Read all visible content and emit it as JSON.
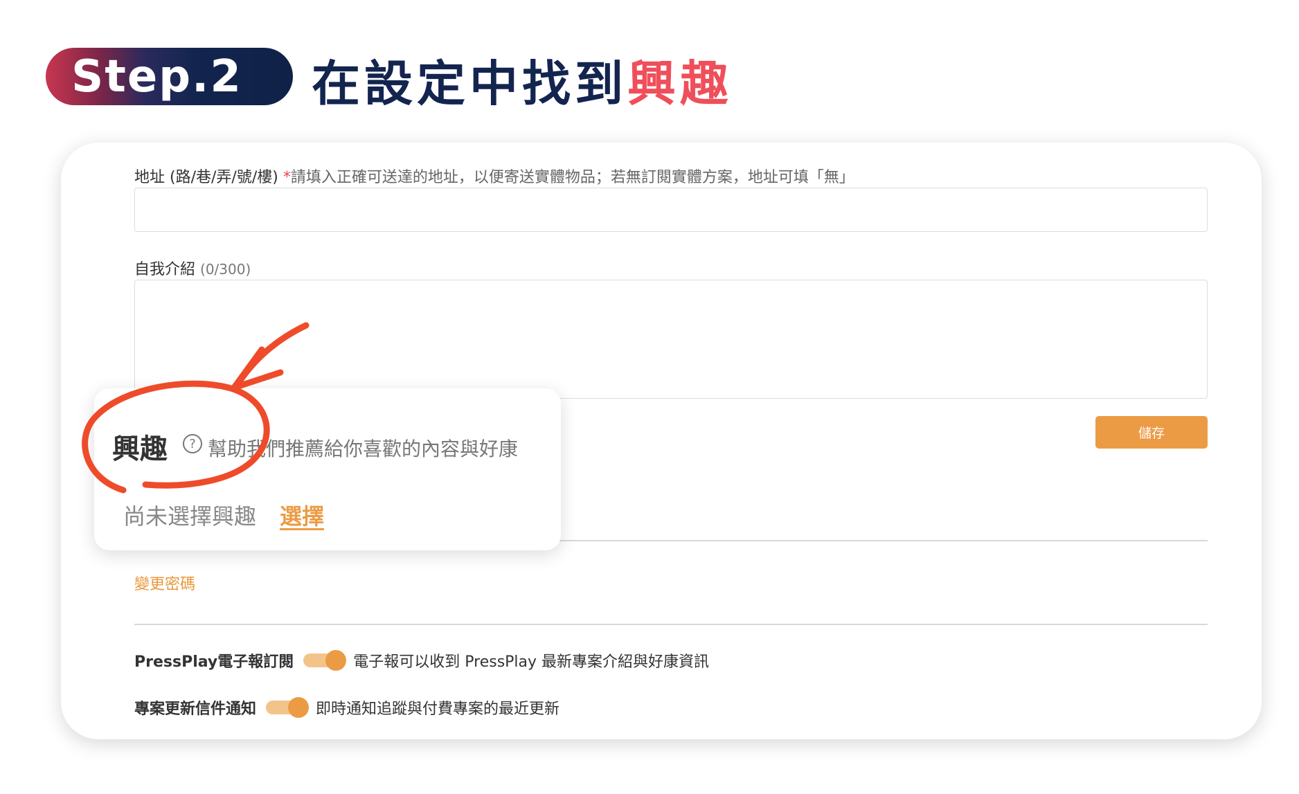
{
  "header": {
    "step_label": "Step.2",
    "title_main": "在設定中找到",
    "title_highlight": "興趣"
  },
  "form": {
    "address": {
      "label": "地址 (路/巷/弄/號/樓)",
      "required_mark": "*",
      "hint": "請填入正確可送達的地址，以便寄送實體物品；若無訂閱實體方案，地址可填「無」",
      "value": ""
    },
    "bio": {
      "label": "自我介紹",
      "counter": "(0/300)",
      "value": ""
    },
    "save_label": "儲存"
  },
  "interest_popup": {
    "title": "興趣",
    "help_icon": "?",
    "description": "幫助我們推薦給你喜歡的內容與好康",
    "empty_text": "尚未選擇興趣",
    "select_label": "選擇"
  },
  "account": {
    "change_password": "變更密碼"
  },
  "notifications": [
    {
      "label": "PressPlay電子報訂閱",
      "enabled": true,
      "description": "電子報可以收到 PressPlay 最新專案介紹與好康資訊"
    },
    {
      "label": "專案更新信件通知",
      "enabled": true,
      "description": "即時通知追蹤與付費專案的最近更新"
    }
  ],
  "colors": {
    "accent_orange": "#ec9b45",
    "brand_navy": "#13254f",
    "highlight_red": "#ef4f5a",
    "annotation_red": "#ee4b2b"
  }
}
